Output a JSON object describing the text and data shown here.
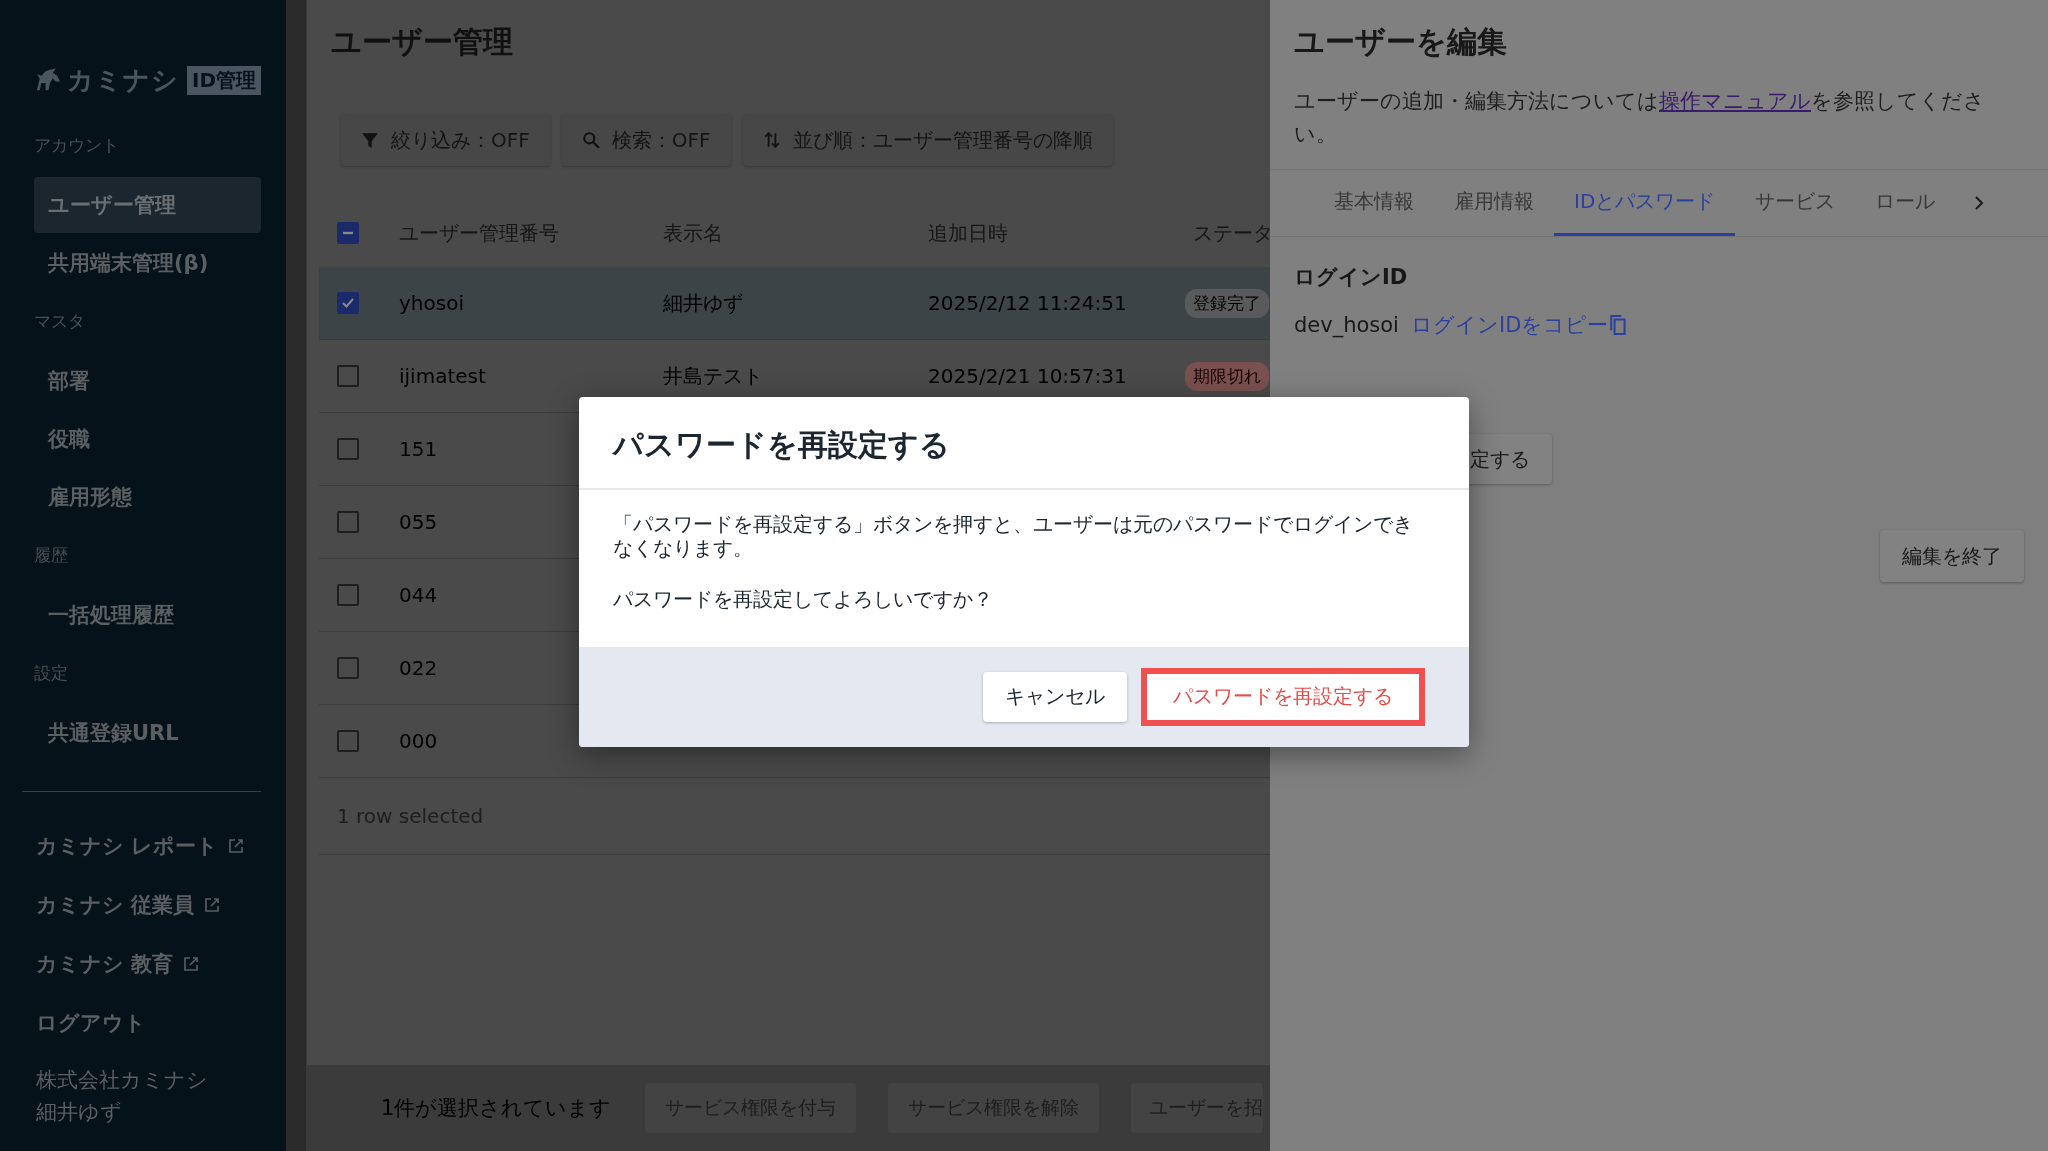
{
  "sidebar": {
    "logo": {
      "wordmark": "カミナシ",
      "badge": "ID管理"
    },
    "sections": [
      {
        "heading": "アカウント",
        "items": [
          {
            "label": "ユーザー管理",
            "selected": true
          },
          {
            "label": "共用端末管理(β)",
            "selected": false
          }
        ]
      },
      {
        "heading": "マスタ",
        "items": [
          {
            "label": "部署",
            "selected": false
          },
          {
            "label": "役職",
            "selected": false
          },
          {
            "label": "雇用形態",
            "selected": false
          }
        ]
      },
      {
        "heading": "履歴",
        "items": [
          {
            "label": "一括処理履歴",
            "selected": false
          }
        ]
      },
      {
        "heading": "設定",
        "items": [
          {
            "label": "共通登録URL",
            "selected": false
          }
        ]
      }
    ],
    "external_links": [
      {
        "label": "カミナシ レポート"
      },
      {
        "label": "カミナシ 従業員"
      },
      {
        "label": "カミナシ 教育"
      }
    ],
    "logout": "ログアウト",
    "company": "株式会社カミナシ",
    "user": "細井ゆず"
  },
  "main": {
    "title": "ユーザー管理",
    "toolbar": [
      {
        "kind": "filter",
        "label": "絞り込み：OFF"
      },
      {
        "kind": "search",
        "label": "検索：OFF"
      },
      {
        "kind": "sort",
        "label": "並び順：ユーザー管理番号の降順"
      }
    ],
    "table": {
      "select_all": {
        "indeterminate": true
      },
      "columns": [
        "ユーザー管理番号",
        "表示名",
        "追加日時",
        "ステータ"
      ],
      "rows": [
        {
          "id": "yhosoi",
          "name": "細井ゆず",
          "added": "2025/2/12 11:24:51",
          "status": {
            "label": "登録完了",
            "kind": "done"
          },
          "checked": true
        },
        {
          "id": "ijimatest",
          "name": "井島テスト",
          "added": "2025/2/21 10:57:31",
          "status": {
            "label": "期限切れ",
            "kind": "expired"
          },
          "checked": false
        },
        {
          "id": "151",
          "checked": false
        },
        {
          "id": "055",
          "checked": false
        },
        {
          "id": "044",
          "checked": false
        },
        {
          "id": "022",
          "checked": false
        },
        {
          "id": "000",
          "checked": false
        }
      ],
      "footer": "1 row selected"
    },
    "bulk_bar": {
      "count": "1件が選択されています",
      "buttons": [
        "サービス権限を付与",
        "サービス権限を解除",
        "ユーザーを招"
      ]
    }
  },
  "drawer": {
    "title": "ユーザーを編集",
    "description": {
      "before": "ユーザーの追加・編集方法については",
      "link": "操作マニュアル",
      "after": "を参照してください。"
    },
    "tabs": [
      {
        "label": "基本情報",
        "selected": false
      },
      {
        "label": "雇用情報",
        "selected": false
      },
      {
        "label": "IDとパスワード",
        "selected": true
      },
      {
        "label": "サービス",
        "selected": false
      },
      {
        "label": "ロール",
        "selected": false
      }
    ],
    "login_id": {
      "heading": "ログインID",
      "value": "dev_hosoi",
      "copy": "ログインIDをコピー"
    },
    "reset_button": "定する",
    "close_button": "編集を終了"
  },
  "dialog": {
    "title": "パスワードを再設定する",
    "message": "「パスワードを再設定する」ボタンを押すと、ユーザーは元のパスワードでログインできなくなります。",
    "question": "パスワードを再設定してよろしいですか？",
    "cancel": "キャンセル",
    "confirm": "パスワードを再設定する"
  }
}
